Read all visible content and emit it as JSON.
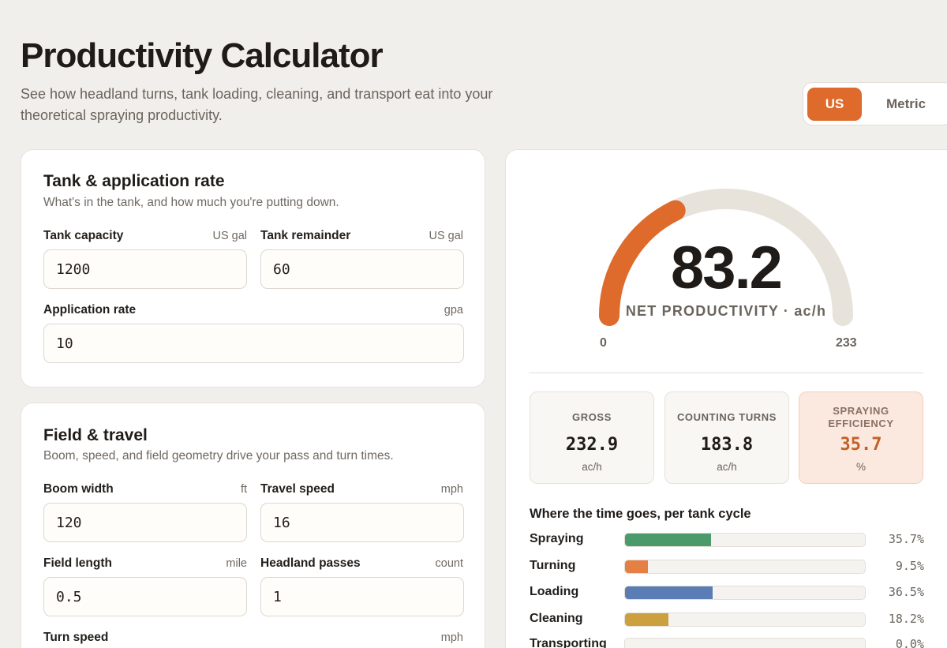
{
  "header": {
    "title": "Productivity Calculator",
    "subtitle": "See how headland turns, tank loading, cleaning, and transport eat into your theoretical spraying productivity."
  },
  "units": {
    "active": "US",
    "other": "Metric"
  },
  "tank_card": {
    "title": "Tank & application rate",
    "description": "What's in the tank, and how much you're putting down.",
    "tank_capacity": {
      "label": "Tank capacity",
      "unit": "US gal",
      "value": "1200"
    },
    "tank_remainder": {
      "label": "Tank remainder",
      "unit": "US gal",
      "value": "60"
    },
    "application_rate": {
      "label": "Application rate",
      "unit": "gpa",
      "value": "10"
    }
  },
  "field_card": {
    "title": "Field & travel",
    "description": "Boom, speed, and field geometry drive your pass and turn times.",
    "boom_width": {
      "label": "Boom width",
      "unit": "ft",
      "value": "120"
    },
    "travel_speed": {
      "label": "Travel speed",
      "unit": "mph",
      "value": "16"
    },
    "field_length": {
      "label": "Field length",
      "unit": "mile",
      "value": "0.5"
    },
    "headland_passes": {
      "label": "Headland passes",
      "unit": "count",
      "value": "1"
    },
    "turn_speed": {
      "label": "Turn speed",
      "unit": "mph"
    }
  },
  "results": {
    "gauge": {
      "value": "83.2",
      "label": "NET PRODUCTIVITY · ac/h",
      "min": "0",
      "max": "233",
      "fraction": 0.357,
      "color": "#de6a2b"
    },
    "stats": {
      "gross": {
        "title": "GROSS",
        "value": "232.9",
        "unit": "ac/h"
      },
      "turns": {
        "title": "COUNTING TURNS",
        "value": "183.8",
        "unit": "ac/h"
      },
      "efficiency": {
        "title_line1": "SPRAYING",
        "title_line2": "EFFICIENCY",
        "value": "35.7",
        "unit": "%"
      }
    },
    "breakdown_title": "Where the time goes, per tank cycle",
    "breakdown": [
      {
        "name": "Spraying",
        "pct": "35.7%",
        "fraction": 0.357,
        "color": "#4a9a6b"
      },
      {
        "name": "Turning",
        "pct": "9.5%",
        "fraction": 0.095,
        "color": "#e57f44"
      },
      {
        "name": "Loading",
        "pct": "36.5%",
        "fraction": 0.365,
        "color": "#5a7db5"
      },
      {
        "name": "Cleaning",
        "pct": "18.2%",
        "fraction": 0.182,
        "color": "#cda03f"
      },
      {
        "name": "Transporting",
        "pct": "0.0%",
        "fraction": 0.0,
        "color": "#8a7f76"
      }
    ]
  }
}
